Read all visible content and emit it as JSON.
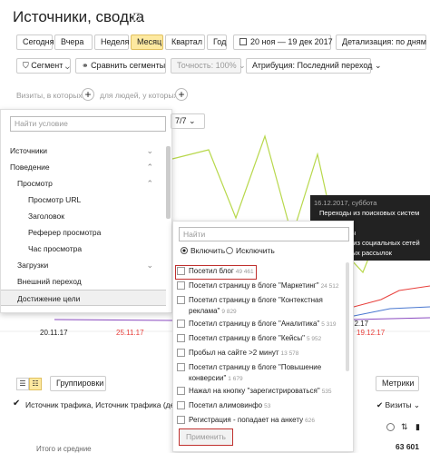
{
  "header": {
    "title": "Источники, сводка"
  },
  "periods": [
    "Сегодня",
    "Вчера",
    "Неделя",
    "Месяц",
    "Квартал",
    "Год"
  ],
  "active_period": "Месяц",
  "date_range": "20 ноя — 19 дек 2017",
  "detail": "Детализация: по дням",
  "toolbar": {
    "segment": "Сегмент",
    "compare": "Сравнить сегменты",
    "accuracy": "Точность: 100%",
    "attribution": "Атрибуция: Последний переход"
  },
  "filter": {
    "visits_who": "Визиты, в которых",
    "people_who": "для людей, у которых"
  },
  "condition_search": {
    "placeholder": "Найти условие"
  },
  "pager": "7/7",
  "tree": [
    {
      "label": "Источники",
      "chev": "⌄"
    },
    {
      "label": "Поведение",
      "chev": "⌃"
    },
    {
      "label": "Просмотр",
      "chev": "⌃"
    },
    {
      "label": "Просмотр URL",
      "chev": ""
    },
    {
      "label": "Заголовок",
      "chev": ""
    },
    {
      "label": "Реферер просмотра",
      "chev": ""
    },
    {
      "label": "Час просмотра",
      "chev": ""
    },
    {
      "label": "Загрузки",
      "chev": "⌄"
    },
    {
      "label": "Внешний переход",
      "chev": ""
    },
    {
      "label": "Достижение цели",
      "chev": ""
    }
  ],
  "goals": {
    "search_placeholder": "Найти",
    "include": "Включить",
    "exclude": "Исключить",
    "items": [
      {
        "label": "Посетил блог",
        "count": "49 461"
      },
      {
        "label": "Посетил страницу в блоге \"Маркетинг\"",
        "count": "24 512"
      },
      {
        "label": "Посетил страницу в блоге \"Контекстная",
        "label2": "реклама\"",
        "count": "9 829"
      },
      {
        "label": "Посетил страницу в блоге \"Аналитика\"",
        "count": "5 319"
      },
      {
        "label": "Посетил страницу в блоге \"Кейсы\"",
        "count": "5 952"
      },
      {
        "label": "Пробыл на сайте >2 минут",
        "count": "13 578"
      },
      {
        "label": "Посетил страницу в блоге \"Повышение",
        "label2": "конверсии\"",
        "count": "1 679"
      },
      {
        "label": "Нажал на кнопку \"зарегистрироваться\"",
        "count": "535"
      },
      {
        "label": "Посетил алимовинфо",
        "count": "53"
      },
      {
        "label": "Регистрация - попадает на анкету",
        "count": "626"
      }
    ],
    "apply": "Применить"
  },
  "tooltip": {
    "date": "16.12.2017, суббота",
    "lines": [
      "Переходы из поисковых систем",
      "...ходы",
      "...переходы",
      "Переходы из социальных сетей",
      "...с почтовых рассылок"
    ]
  },
  "chart_data": {
    "type": "line",
    "x_labels": [
      "20.11.17",
      "25.11.17"
    ],
    "right_labels": [
      "12.17",
      "19.12.17"
    ]
  },
  "bottom": {
    "grouping": "Группировки",
    "metrics": "Метрики",
    "dimension": "Источник трафика, Источник трафика (дета",
    "visits_col": "Визиты",
    "totals": "Итого и средние",
    "totals_value": "63 601"
  },
  "colors": {
    "accent": "#fde9a0",
    "green": "#b8d84c",
    "red": "#e8403c",
    "blue": "#4a78d0",
    "purple": "#8a4ac0"
  }
}
